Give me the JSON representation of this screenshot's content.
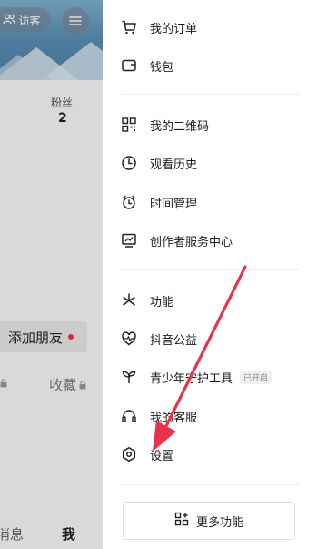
{
  "background_page": {
    "visitor_label": "访客",
    "fans_label": "粉丝",
    "fans_count": "2",
    "add_friend_label": "添加朋友",
    "collect_label": "收藏",
    "tab_messages": "消息",
    "tab_me": "我"
  },
  "drawer": {
    "items": [
      {
        "label": "我的订单",
        "icon": "cart-icon"
      },
      {
        "label": "钱包",
        "icon": "wallet-icon"
      },
      {
        "label": "我的二维码",
        "icon": "qr-code-icon"
      },
      {
        "label": "观看历史",
        "icon": "clock-icon"
      },
      {
        "label": "时间管理",
        "icon": "alarm-clock-icon"
      },
      {
        "label": "创作者服务中心",
        "icon": "chart-monitor-icon"
      },
      {
        "label": "功能",
        "icon": "sparkle-icon"
      },
      {
        "label": "抖音公益",
        "icon": "heart-pulse-icon"
      },
      {
        "label": "青少年守护工具",
        "icon": "sprout-icon",
        "badge": "已开启"
      },
      {
        "label": "我的客服",
        "icon": "headset-icon"
      },
      {
        "label": "设置",
        "icon": "hexagon-gear-icon"
      }
    ],
    "more_button_label": "更多功能"
  },
  "colors": {
    "annotation_arrow": "#e8334a",
    "accent_red": "#e8334a"
  }
}
